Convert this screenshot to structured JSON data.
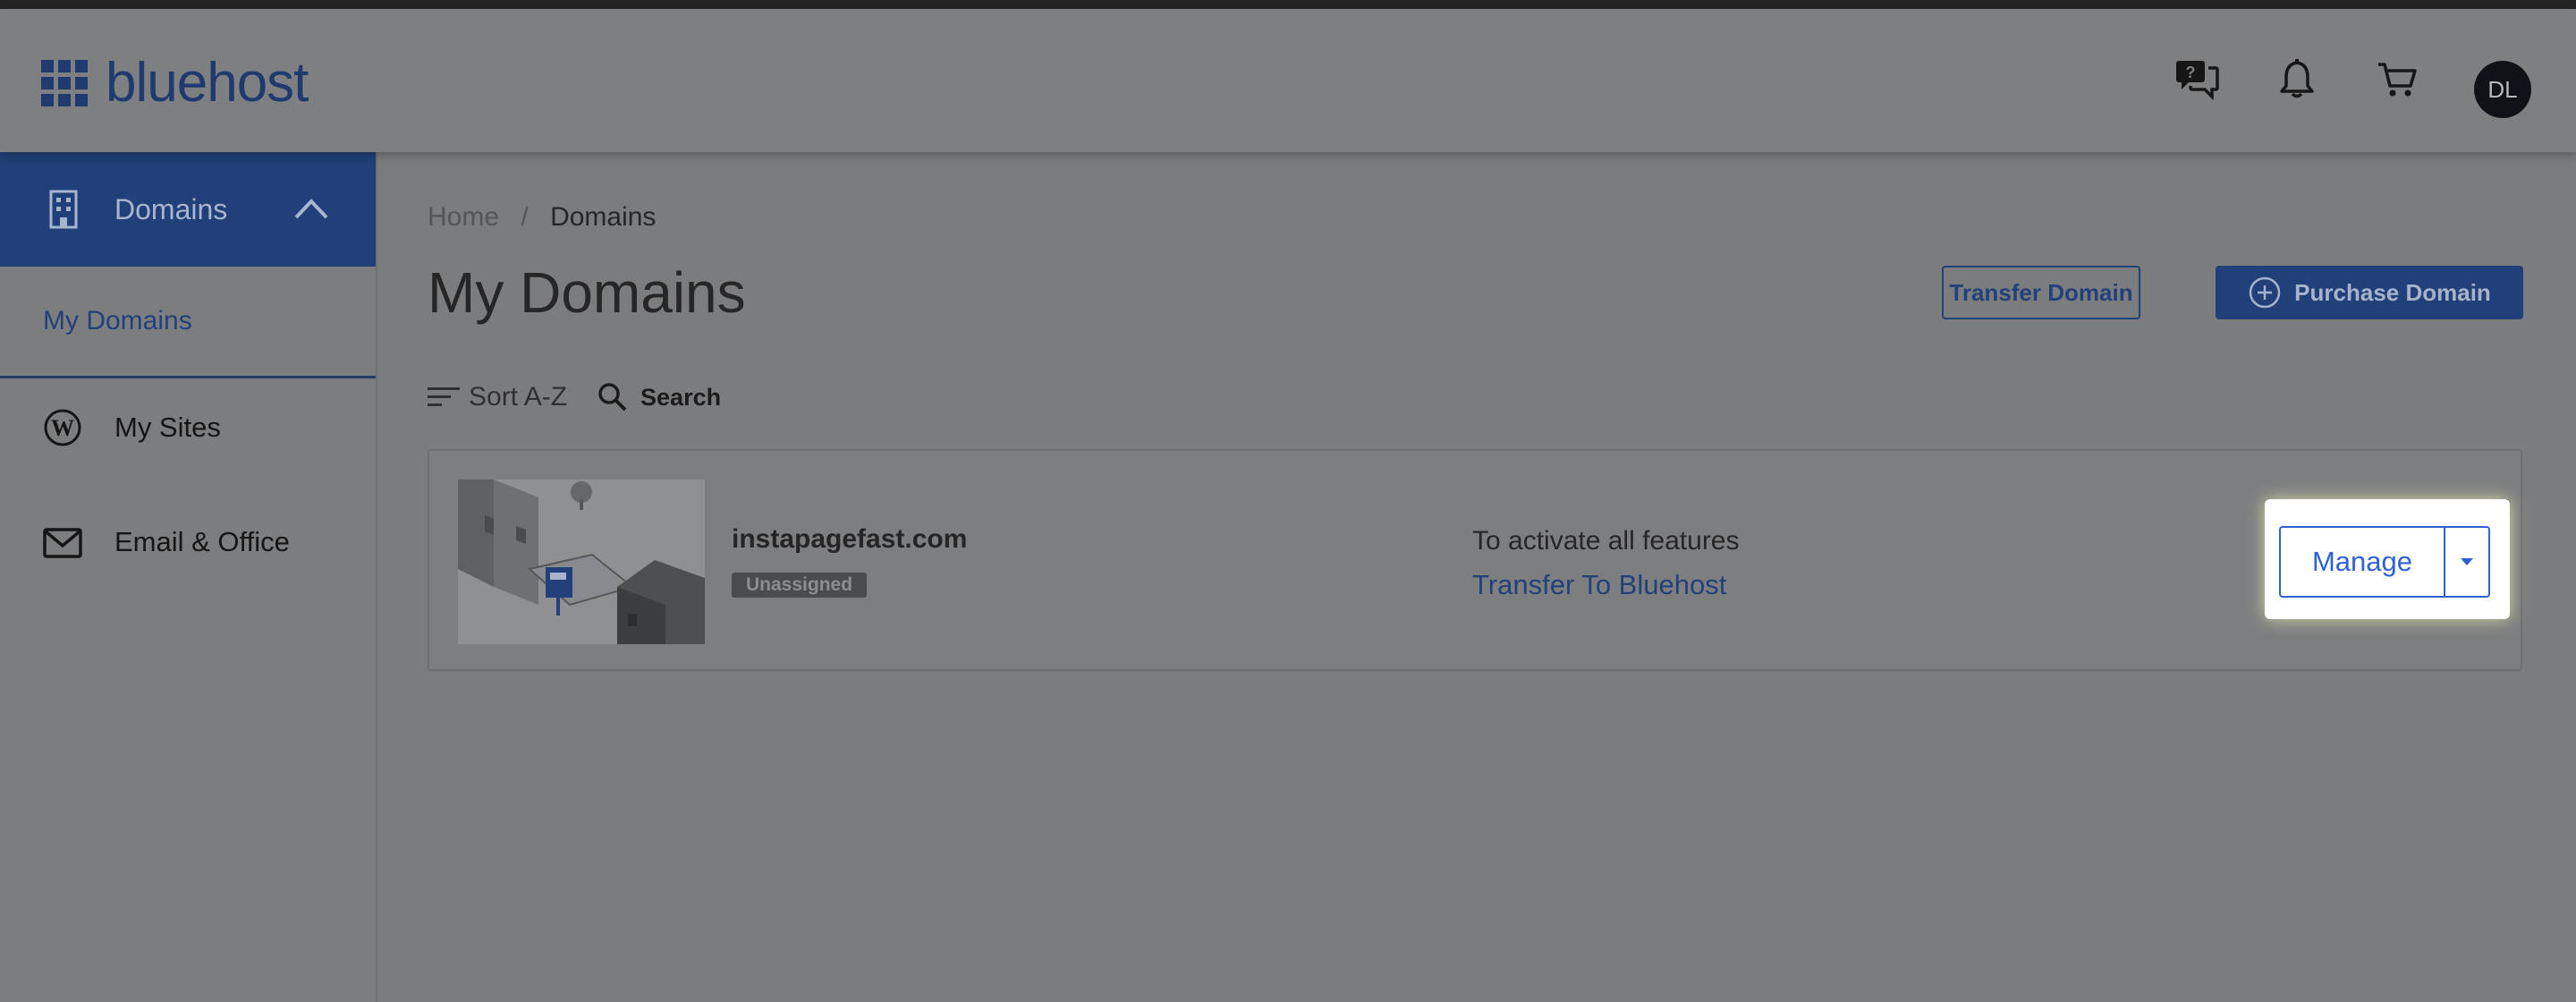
{
  "brand": {
    "logo_text": "bluehost",
    "color": "#1e3a6f"
  },
  "header": {
    "icons": [
      "help-chat-icon",
      "bell-icon",
      "cart-icon"
    ],
    "avatar_initials": "DL"
  },
  "sidebar": {
    "items": [
      {
        "label": "Domains",
        "icon": "building-icon",
        "expanded": true
      },
      {
        "label": "My Domains"
      },
      {
        "label": "My Sites",
        "icon": "wordpress-icon"
      },
      {
        "label": "Email & Office",
        "icon": "envelope-icon"
      }
    ]
  },
  "breadcrumb": {
    "home": "Home",
    "separator": "/",
    "current": "Domains"
  },
  "page": {
    "title": "My Domains",
    "transfer_button": "Transfer Domain",
    "purchase_button": "Purchase Domain"
  },
  "toolbar": {
    "sort_label": "Sort A-Z",
    "search_label": "Search"
  },
  "domain_card": {
    "domain": "instapagefast.com",
    "status_badge": "Unassigned",
    "activate_text": "To activate all features",
    "transfer_link": "Transfer To Bluehost",
    "manage_button": "Manage"
  },
  "colors": {
    "accent": "#2f62d0",
    "sidebar_active": "#214079",
    "overlay_bg": "#7b7c7e"
  }
}
